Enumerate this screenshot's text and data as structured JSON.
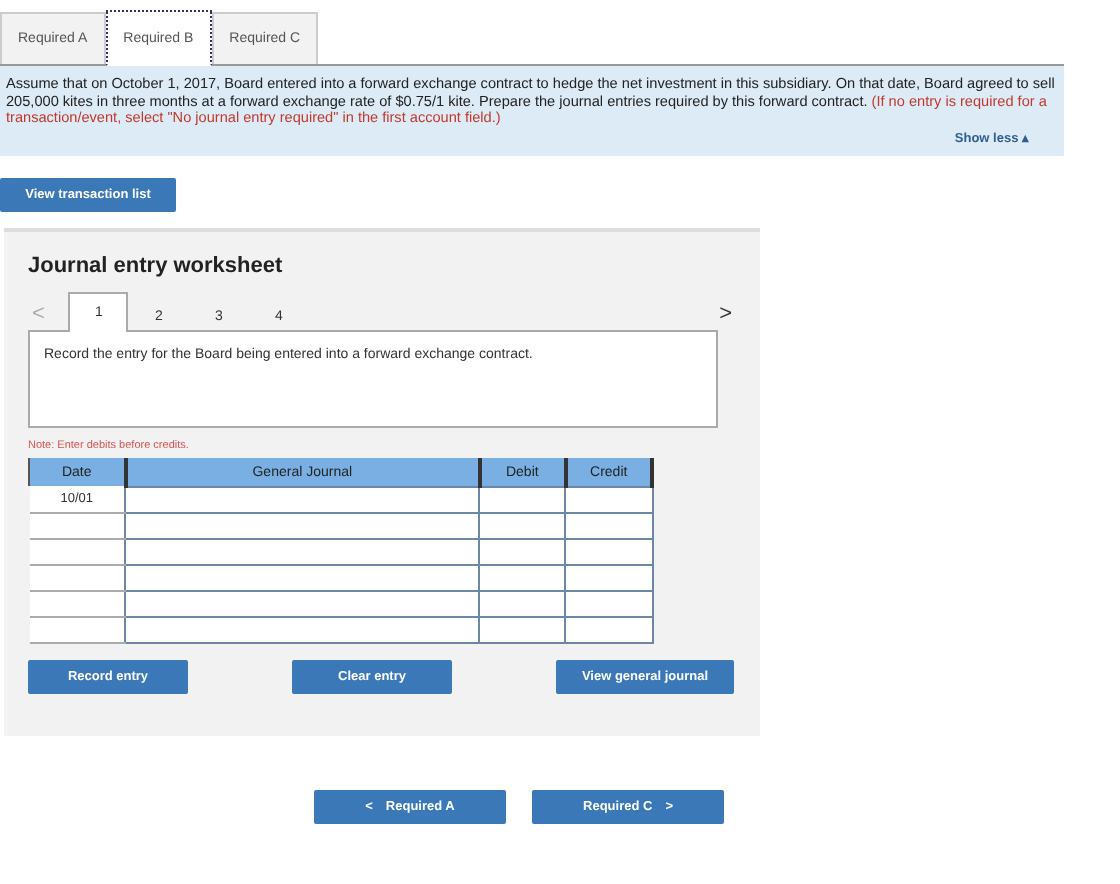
{
  "tabs": [
    {
      "label": "Required A",
      "selected": false
    },
    {
      "label": "Required B",
      "selected": true
    },
    {
      "label": "Required C",
      "selected": false
    }
  ],
  "instructions": {
    "text": "Assume that on October 1, 2017, Board entered into a forward exchange contract to hedge the net investment in this subsidiary. On that date, Board agreed to sell 205,000 kites in three months at a forward exchange rate of $0.75/1 kite. Prepare the journal entries required by this forward contract.",
    "note": "(If no entry is required for a transaction/event, select \"No journal entry  required\" in the first account field.)",
    "toggle": "Show less ▴"
  },
  "view_transaction_list": "View transaction list",
  "worksheet": {
    "title": "Journal entry worksheet",
    "prev": "<",
    "next": ">",
    "steps": [
      {
        "label": "1",
        "selected": true
      },
      {
        "label": "2",
        "selected": false
      },
      {
        "label": "3",
        "selected": false
      },
      {
        "label": "4",
        "selected": false
      }
    ],
    "prompt": "Record the entry for the Board being entered into a forward exchange contract.",
    "note": "Note: Enter debits before credits.",
    "table": {
      "columns": [
        "Date",
        "General Journal",
        "Debit",
        "Credit"
      ],
      "rows": [
        {
          "date": "10/01"
        },
        {
          "date": ""
        },
        {
          "date": ""
        },
        {
          "date": ""
        },
        {
          "date": ""
        },
        {
          "date": ""
        }
      ]
    },
    "buttons": [
      "Record entry",
      "Clear entry",
      "View general journal"
    ]
  },
  "nav": {
    "prev": {
      "arrow": "<",
      "label": "Required A"
    },
    "next": {
      "label": "Required C",
      "arrow": ">"
    }
  }
}
